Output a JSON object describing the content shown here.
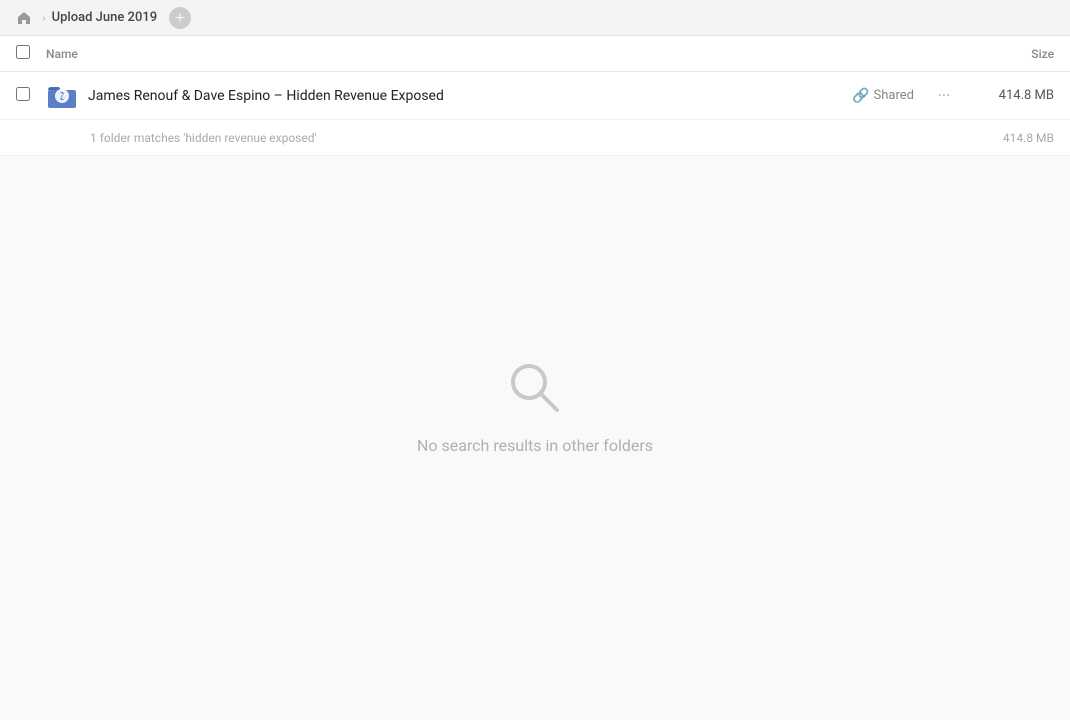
{
  "breadcrumb": {
    "home_label": "Home",
    "current_folder": "Upload June 2019",
    "add_button_label": "+"
  },
  "table": {
    "col_name": "Name",
    "col_size": "Size"
  },
  "file_row": {
    "name": "James Renouf & Dave Espino – Hidden Revenue Exposed",
    "shared_label": "Shared",
    "size": "414.8 MB",
    "more_icon": "···"
  },
  "match_row": {
    "text": "1 folder matches 'hidden revenue exposed'",
    "size": "414.8 MB"
  },
  "empty_state": {
    "message": "No search results in other folders"
  }
}
